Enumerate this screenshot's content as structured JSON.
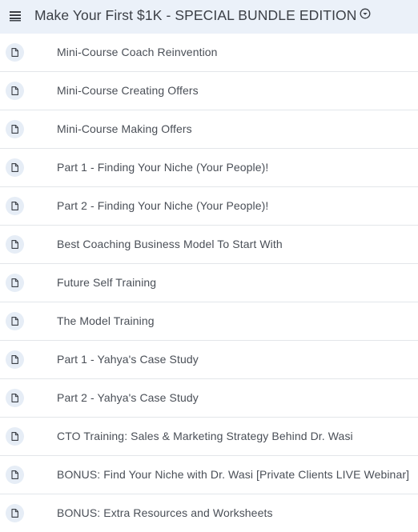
{
  "header": {
    "title": "Make Your First $1K - SPECIAL BUNDLE EDITION",
    "menu_icon": "hamburger-menu-icon",
    "title_icon": "circle-chevron-down-icon"
  },
  "lessons": [
    {
      "label": "Mini-Course Coach Reinvention",
      "icon": "document-icon"
    },
    {
      "label": "Mini-Course Creating Offers",
      "icon": "document-icon"
    },
    {
      "label": "Mini-Course Making Offers",
      "icon": "document-icon"
    },
    {
      "label": "Part 1 - Finding Your Niche (Your People)!",
      "icon": "document-icon"
    },
    {
      "label": "Part 2 - Finding Your Niche (Your People)!",
      "icon": "document-icon"
    },
    {
      "label": "Best Coaching Business Model To Start With",
      "icon": "document-icon"
    },
    {
      "label": "Future Self Training",
      "icon": "document-icon"
    },
    {
      "label": "The Model Training",
      "icon": "document-icon"
    },
    {
      "label": "Part 1 - Yahya's Case Study",
      "icon": "document-icon"
    },
    {
      "label": "Part 2 - Yahya's Case Study",
      "icon": "document-icon"
    },
    {
      "label": "CTO Training: Sales & Marketing Strategy Behind Dr. Wasi",
      "icon": "document-icon"
    },
    {
      "label": "BONUS: Find Your Niche with Dr. Wasi [Private Clients LIVE Webinar]",
      "icon": "document-icon"
    },
    {
      "label": "BONUS: Extra Resources and Worksheets",
      "icon": "document-icon"
    }
  ],
  "colors": {
    "header_bg": "#ebf1f9",
    "row_border": "#e3e6ea",
    "text": "#4a4f57",
    "icon_badge": "#e6edf6"
  }
}
